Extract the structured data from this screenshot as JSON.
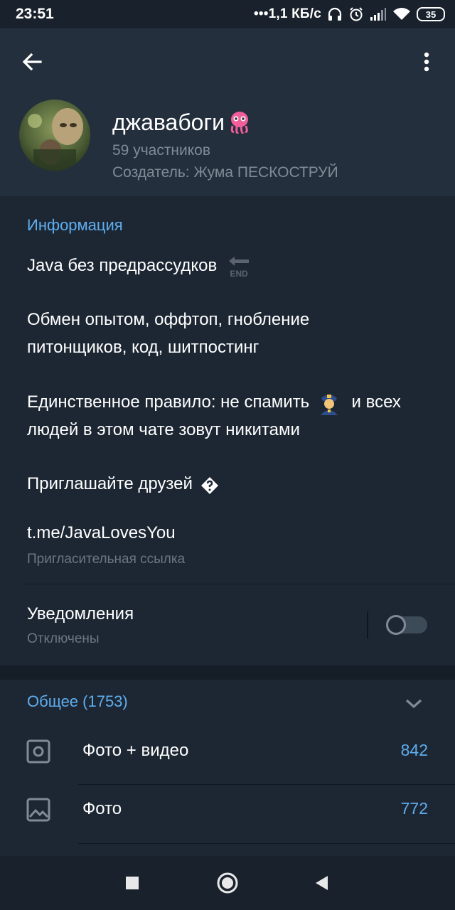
{
  "status_bar": {
    "time": "23:51",
    "net_speed": "•••1,1 КБ/с",
    "battery": "35",
    "icons": [
      "headphones-icon",
      "alarm-icon",
      "signal-icon",
      "wifi-icon",
      "battery-icon"
    ]
  },
  "header": {
    "group_name": "джавабоги",
    "members": "59 участников",
    "creator": "Создатель: Жума ПЕСКОСТРУЙ"
  },
  "info": {
    "section_title": "Информация",
    "desc_line1": "Java без предрассудков",
    "desc_line1_emoji_text": "END",
    "desc_para2_line1": "Обмен опытом, оффтоп, гнобление",
    "desc_para2_line2": "питонщиков, код, шитпостинг",
    "desc_para3_line1a": "Единственное правило: не спамить",
    "desc_para3_line1b": "и всех",
    "desc_para3_line2": "людей в этом чате зовут никитами",
    "desc_para4": "Приглашайте друзей",
    "invite_link": "t.me/JavaLovesYou",
    "invite_link_label": "Пригласительная ссылка",
    "notifications_title": "Уведомления",
    "notifications_status": "Отключены",
    "notifications_enabled": false
  },
  "media": {
    "section_title": "Общее (1753)",
    "rows": [
      {
        "label": "Фото + видео",
        "count": "842",
        "icon": "photo-video-icon"
      },
      {
        "label": "Фото",
        "count": "772",
        "icon": "photo-icon"
      }
    ]
  },
  "colors": {
    "accent": "#5eaef0",
    "header_bg": "#242f3d",
    "page_bg": "#1d2733",
    "muted_text": "#7f8b97"
  }
}
